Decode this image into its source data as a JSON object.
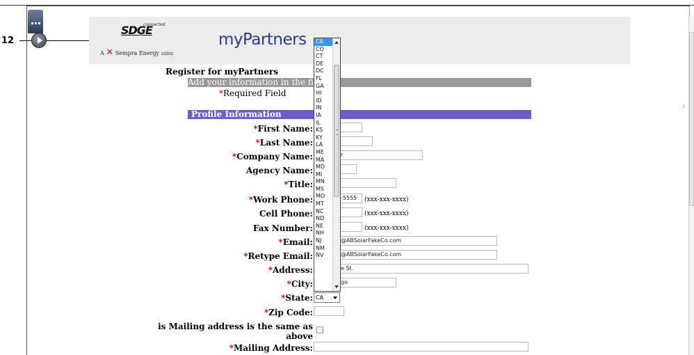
{
  "step": {
    "number": "12"
  },
  "banner": {
    "logo": "SDGE",
    "logo_tag": "connected",
    "parent_company": "Sempra Energy",
    "parent_suffix": "utility",
    "brand": "myPartners"
  },
  "form": {
    "title": "Register for myPartners",
    "instructions": "Add your information in the fields b",
    "required_star": "*",
    "required_note": "Required Field",
    "section_profile": "Profile Information",
    "fields": {
      "first_name": {
        "label": "First Name:",
        "value": ""
      },
      "last_name": {
        "label": "Last Name:",
        "value": ""
      },
      "company_name": {
        "label": "Company Name:",
        "value": "r"
      },
      "agency_name": {
        "label": "Agency Name:",
        "value": ""
      },
      "title": {
        "label": "Title:",
        "value": ""
      },
      "work_phone": {
        "label": "Work Phone:",
        "value": "-5555",
        "hint": "(xxx-xxx-xxxx)"
      },
      "cell_phone": {
        "label": "Cell Phone:",
        "value": "",
        "hint": "(xxx-xxx-xxxx)"
      },
      "fax_number": {
        "label": "Fax Number:",
        "value": "",
        "hint": "(xxx-xxx-xxxx)"
      },
      "email": {
        "label": "Email:",
        "value": "@ABSolarFakeCo.com"
      },
      "retype_email": {
        "label": "Retype Email:",
        "value": "@ABSolarFakeCo.com"
      },
      "address": {
        "label": "Address:",
        "value": "e St."
      },
      "city": {
        "label": "City:",
        "value": "go"
      },
      "state": {
        "label": "State:",
        "value": "CA"
      },
      "zip_code": {
        "label": "Zip Code:",
        "value": ""
      },
      "mailing_same_line1": "is Mailing address is the same as",
      "mailing_same_line2": "above",
      "mailing_address": {
        "label": "Mailing Address:",
        "value": ""
      }
    }
  },
  "state_dropdown": {
    "selected": "CA",
    "options": [
      "CA",
      "CO",
      "CT",
      "DE",
      "DC",
      "FL",
      "GA",
      "HI",
      "ID",
      "IN",
      "IA",
      "IL",
      "KS",
      "KY",
      "LA",
      "ME",
      "MA",
      "MD",
      "MI",
      "MN",
      "MS",
      "MO",
      "MT",
      "NC",
      "ND",
      "NE",
      "NH",
      "NJ",
      "NM",
      "NV"
    ]
  },
  "colors": {
    "instructions_bar": "#999999",
    "profile_bar": "#6a5fc8",
    "required": "#c00000",
    "brand": "#2e3a87",
    "selected_option": "#3399ff"
  }
}
